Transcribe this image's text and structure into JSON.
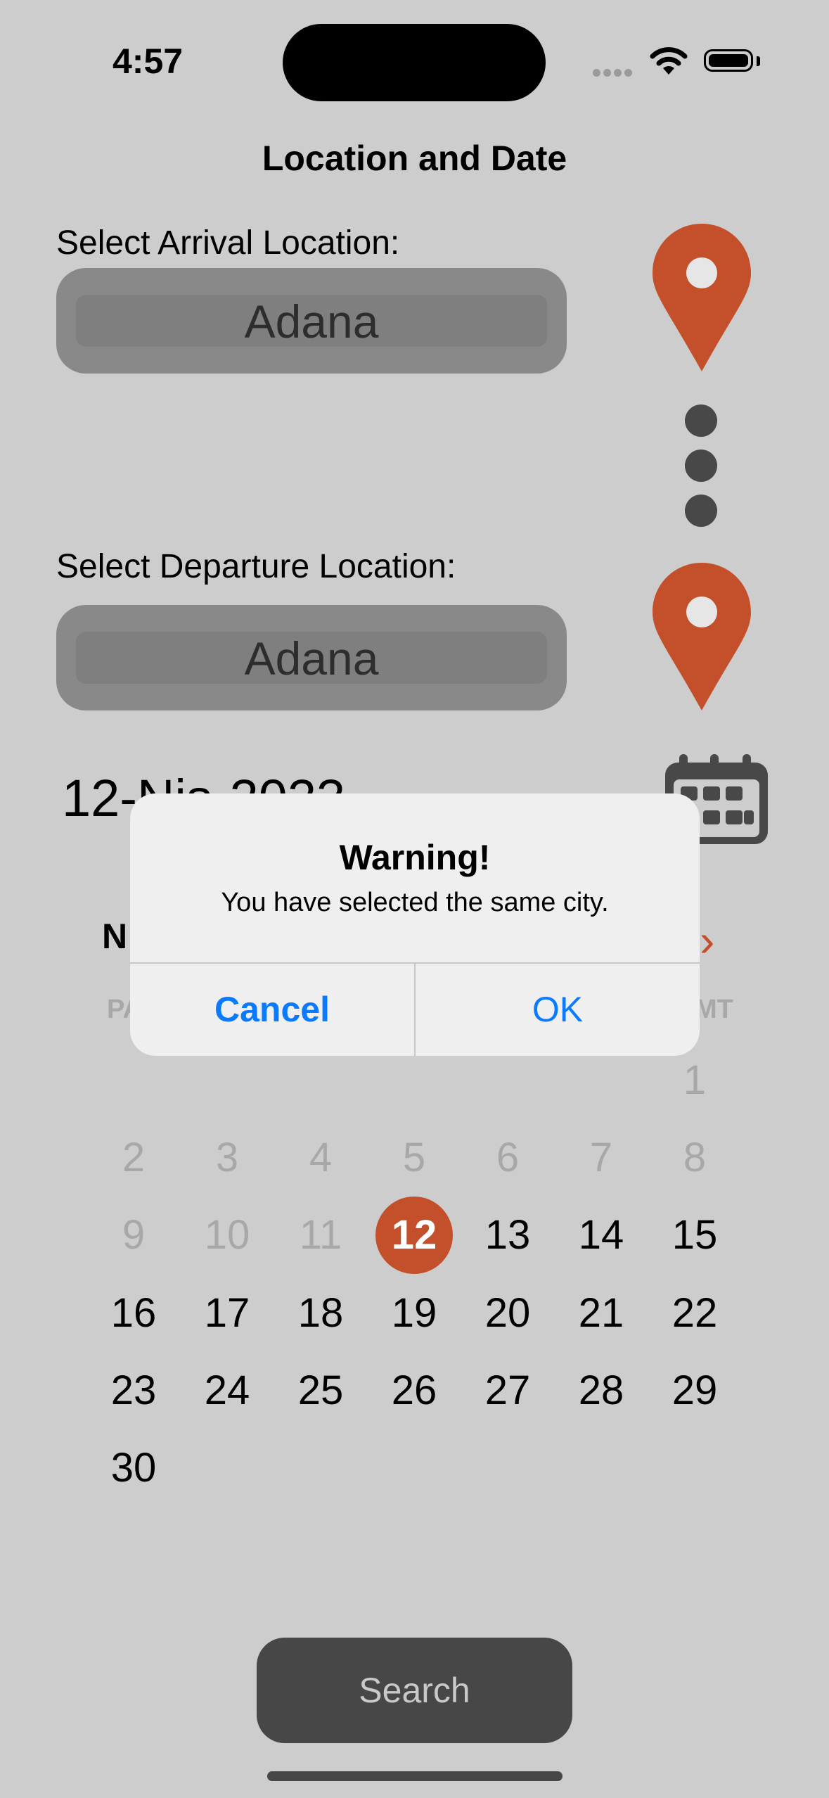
{
  "status": {
    "time": "4:57"
  },
  "nav": {
    "title": "Location and Date"
  },
  "arrival": {
    "label": "Select Arrival Location:",
    "value": "Adana"
  },
  "departure": {
    "label": "Select Departure Location:",
    "value": "Adana"
  },
  "date": {
    "text": "12-Nis-2023"
  },
  "calendar": {
    "month_label": "N",
    "weekdays": [
      "PA",
      "MT"
    ],
    "selected_day": "12",
    "rows": [
      [
        {
          "d": "",
          "dim": true
        },
        {
          "d": "",
          "dim": true
        },
        {
          "d": "",
          "dim": true
        },
        {
          "d": "",
          "dim": true
        },
        {
          "d": "",
          "dim": true
        },
        {
          "d": "",
          "dim": true
        },
        {
          "d": "1",
          "dim": true
        }
      ],
      [
        {
          "d": "2",
          "dim": true
        },
        {
          "d": "3",
          "dim": true
        },
        {
          "d": "4",
          "dim": true
        },
        {
          "d": "5",
          "dim": true
        },
        {
          "d": "6",
          "dim": true
        },
        {
          "d": "7",
          "dim": true
        },
        {
          "d": "8",
          "dim": true
        }
      ],
      [
        {
          "d": "9",
          "dim": true
        },
        {
          "d": "10",
          "dim": true
        },
        {
          "d": "11",
          "dim": true
        },
        {
          "d": "12",
          "dim": false
        },
        {
          "d": "13",
          "dim": false
        },
        {
          "d": "14",
          "dim": false
        },
        {
          "d": "15",
          "dim": false
        }
      ],
      [
        {
          "d": "16",
          "dim": false
        },
        {
          "d": "17",
          "dim": false
        },
        {
          "d": "18",
          "dim": false
        },
        {
          "d": "19",
          "dim": false
        },
        {
          "d": "20",
          "dim": false
        },
        {
          "d": "21",
          "dim": false
        },
        {
          "d": "22",
          "dim": false
        }
      ],
      [
        {
          "d": "23",
          "dim": false
        },
        {
          "d": "24",
          "dim": false
        },
        {
          "d": "25",
          "dim": false
        },
        {
          "d": "26",
          "dim": false
        },
        {
          "d": "27",
          "dim": false
        },
        {
          "d": "28",
          "dim": false
        },
        {
          "d": "29",
          "dim": false
        }
      ],
      [
        {
          "d": "30",
          "dim": false
        }
      ]
    ]
  },
  "search": {
    "label": "Search"
  },
  "alert": {
    "title": "Warning!",
    "message": "You have selected the same city.",
    "cancel": "Cancel",
    "ok": "OK"
  },
  "colors": {
    "accent": "#c3502a",
    "link": "#0a7aff",
    "background": "#cdcdcd"
  },
  "icons": {
    "location": "map-pin-icon",
    "calendar": "calendar-icon",
    "next": "chevron-right-icon"
  }
}
